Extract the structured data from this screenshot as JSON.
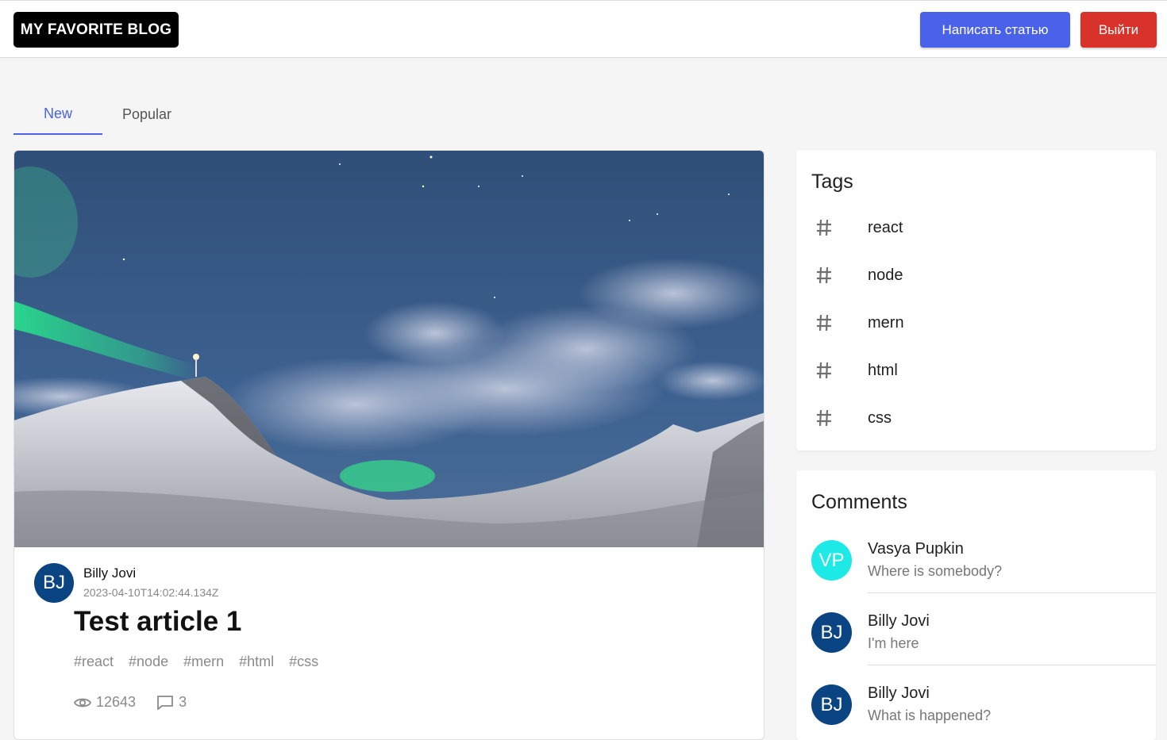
{
  "header": {
    "logo": "MY FAVORITE BLOG",
    "write_button": "Написать статью",
    "logout_button": "Выйти",
    "colors": {
      "primary": "#4a62ea",
      "danger": "#d8322b",
      "logo_bg": "#000000"
    }
  },
  "tabs": [
    {
      "label": "New",
      "active": true
    },
    {
      "label": "Popular",
      "active": false
    }
  ],
  "article": {
    "image": "aurora-over-snowy-mountains",
    "author": {
      "initials": "BJ",
      "name": "Billy Jovi",
      "avatar_color": "#0b4482"
    },
    "date": "2023-04-10T14:02:44.134Z",
    "title": "Test article 1",
    "tags": [
      "#react",
      "#node",
      "#mern",
      "#html",
      "#css"
    ],
    "views": "12643",
    "comments_count": "3",
    "icons": {
      "views": "eye-icon",
      "comments": "comment-icon"
    }
  },
  "tags_panel": {
    "title": "Tags",
    "icon": "hashtag-icon",
    "items": [
      "react",
      "node",
      "mern",
      "html",
      "css"
    ]
  },
  "comments_panel": {
    "title": "Comments",
    "items": [
      {
        "initials": "VP",
        "name": "Vasya Pupkin",
        "text": "Where is somebody?",
        "avatar_color": "#1de9e6"
      },
      {
        "initials": "BJ",
        "name": "Billy Jovi",
        "text": "I'm here",
        "avatar_color": "#0b4482"
      },
      {
        "initials": "BJ",
        "name": "Billy Jovi",
        "text": "What is happened?",
        "avatar_color": "#0b4482"
      }
    ]
  }
}
